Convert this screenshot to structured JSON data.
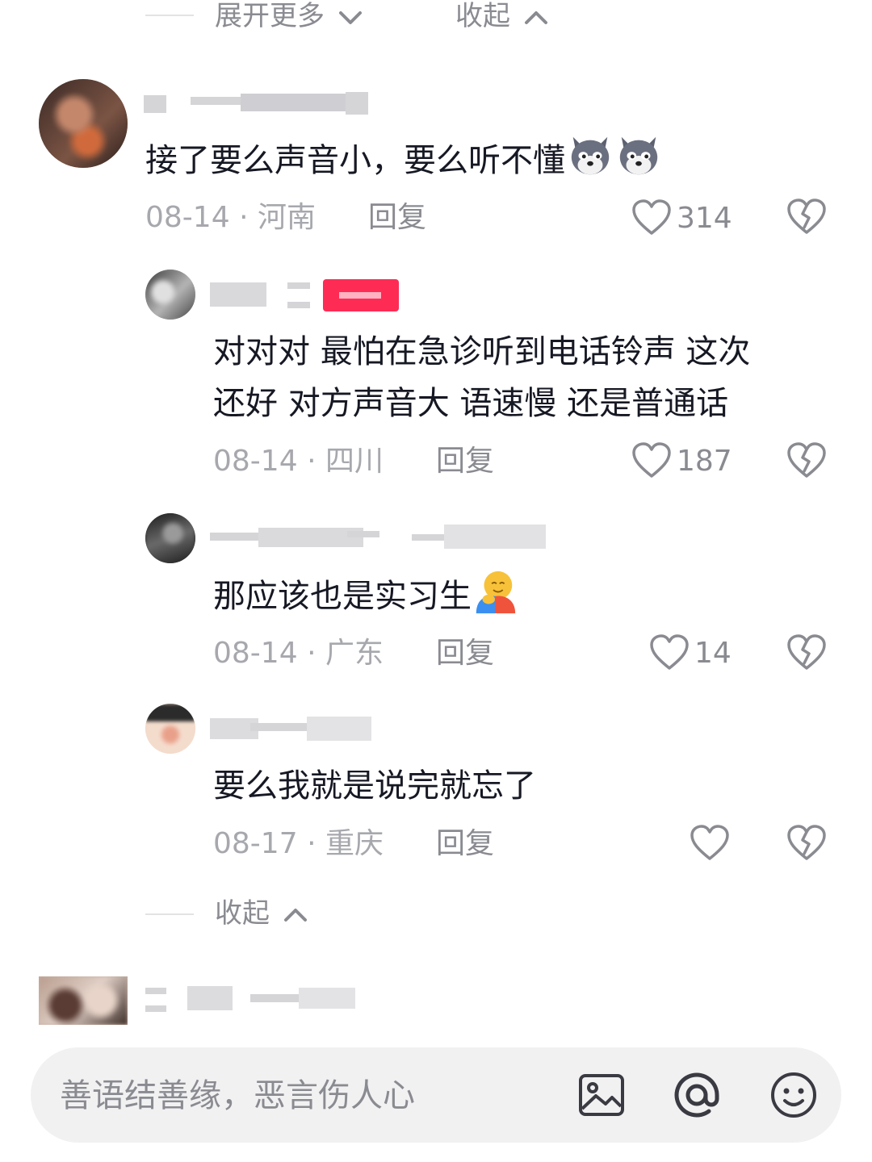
{
  "top_bar": {
    "expand_more_label": "展开更多",
    "collapse_label": "收起"
  },
  "comments": [
    {
      "text": "接了要么声音小，要么听不懂",
      "emoji": [
        "wolf-emoji",
        "wolf-emoji"
      ],
      "date": "08-14",
      "location": "河南",
      "reply_label": "回复",
      "likes": "314"
    }
  ],
  "replies": [
    {
      "text_line1": "对对对  最怕在急诊听到电话铃声  这次",
      "text_line2": "还好 对方声音大 语速慢 还是普通话",
      "date": "08-14",
      "location": "四川",
      "reply_label": "回复",
      "likes": "187"
    },
    {
      "text": "那应该也是实习生",
      "emoji": "hug-emoji",
      "date": "08-14",
      "location": "广东",
      "reply_label": "回复",
      "likes": "14"
    },
    {
      "text": "要么我就是说完就忘了",
      "date": "08-17",
      "location": "重庆",
      "reply_label": "回复",
      "likes": ""
    }
  ],
  "collapse_replies_label": "收起",
  "meta_separator": "·",
  "input_bar": {
    "placeholder": "善语结善缘，恶言伤人心",
    "icons": [
      "image-icon",
      "mention-icon",
      "emoji-icon"
    ]
  },
  "colors": {
    "text_primary": "#161823",
    "text_secondary": "#8a8b91",
    "text_meta": "#a7a8ad",
    "badge": "#fe2c55",
    "input_bg": "#f1f1f2"
  }
}
